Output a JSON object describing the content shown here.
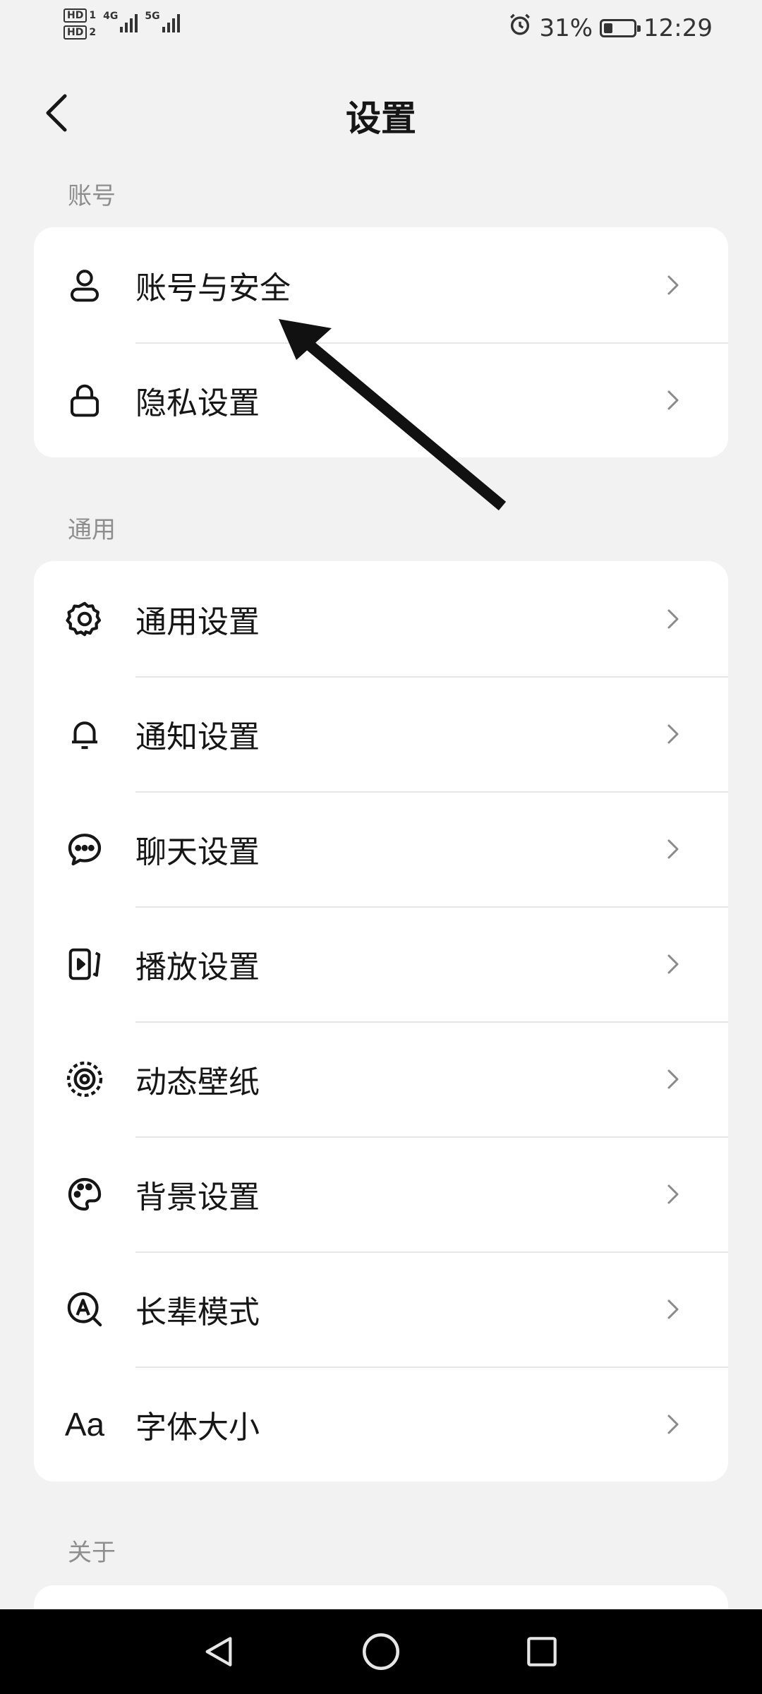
{
  "status_bar": {
    "sim1": "HD",
    "sim1_num": "1",
    "sim2": "HD",
    "sim2_num": "2",
    "net1": "4G",
    "net2": "5G",
    "battery": "31%",
    "battery_level": 0.31,
    "time": "12:29",
    "alarm_icon": "alarm-icon"
  },
  "header": {
    "title": "设置",
    "back_icon": "chevron-left-icon"
  },
  "sections": {
    "account": {
      "label": "账号",
      "items": [
        {
          "label": "账号与安全",
          "icon": "user-icon"
        },
        {
          "label": "隐私设置",
          "icon": "lock-icon"
        }
      ]
    },
    "general": {
      "label": "通用",
      "items": [
        {
          "label": "通用设置",
          "icon": "gear-icon"
        },
        {
          "label": "通知设置",
          "icon": "bell-icon"
        },
        {
          "label": "聊天设置",
          "icon": "chat-bubble-icon"
        },
        {
          "label": "播放设置",
          "icon": "play-screen-icon"
        },
        {
          "label": "动态壁纸",
          "icon": "live-wallpaper-icon"
        },
        {
          "label": "背景设置",
          "icon": "palette-icon"
        },
        {
          "label": "长辈模式",
          "icon": "elder-mode-icon"
        },
        {
          "label": "字体大小",
          "icon": "font-size-icon",
          "icon_text": "Aa"
        }
      ]
    },
    "about": {
      "label": "关于"
    }
  },
  "nav_bar": {
    "back": "triangle-back-icon",
    "home": "circle-home-icon",
    "recents": "square-recents-icon"
  }
}
